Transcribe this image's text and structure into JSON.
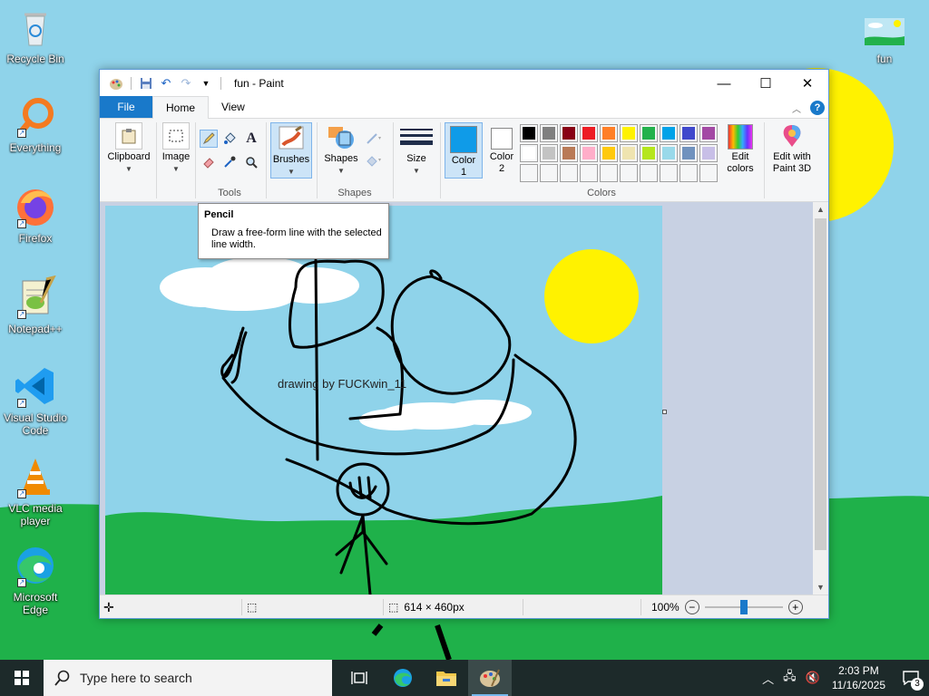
{
  "desktop": {
    "icons": [
      {
        "label": "Recycle Bin",
        "icon": "recycle-bin-icon"
      },
      {
        "label": "Everything",
        "icon": "everything-search-icon"
      },
      {
        "label": "Firefox",
        "icon": "firefox-icon"
      },
      {
        "label": "Notepad++",
        "icon": "notepadpp-icon"
      },
      {
        "label": "Visual Studio Code",
        "icon": "vscode-icon"
      },
      {
        "label": "VLC media player",
        "icon": "vlc-icon"
      },
      {
        "label": "Microsoft Edge",
        "icon": "edge-icon"
      },
      {
        "label": "fun",
        "icon": "image-file-icon"
      }
    ]
  },
  "window": {
    "title": "fun - Paint",
    "tabs": [
      {
        "label": "File"
      },
      {
        "label": "Home"
      },
      {
        "label": "View"
      }
    ],
    "ribbon": {
      "clipboard": "Clipboard",
      "image": "Image",
      "tools": "Tools",
      "brushes": "Brushes",
      "shapes_btn": "Shapes",
      "shapes_group": "Shapes",
      "size": "Size",
      "color1": "Color 1",
      "color2": "Color 2",
      "colors_group": "Colors",
      "edit_colors": "Edit colors",
      "edit_paint3d": "Edit with Paint 3D",
      "text_tool": "A",
      "color1_value": "#0f9be8",
      "color2_value": "#ffffff",
      "palette_row1": [
        "#000000",
        "#7f7f7f",
        "#880015",
        "#ed1c24",
        "#ff7f27",
        "#fff200",
        "#22b14c",
        "#00a2e8",
        "#3f48cc",
        "#a349a4"
      ],
      "palette_row2": [
        "#ffffff",
        "#c3c3c3",
        "#b97a57",
        "#ffaec9",
        "#ffc90e",
        "#efe4b0",
        "#b5e61d",
        "#99d9ea",
        "#7092be",
        "#c8bfe7"
      ]
    },
    "tooltip": {
      "title": "Pencil",
      "body": "Draw a free-form line with the selected line width."
    },
    "canvas": {
      "caption": "drawing by FUCKwin_11"
    },
    "status": {
      "image_size": "614 × 460px",
      "zoom": "100%",
      "zoom_fraction": 0.5
    }
  },
  "taskbar": {
    "search_placeholder": "Type here to search",
    "time": "2:03 PM",
    "date": "11/16/2025",
    "notification_count": "3"
  }
}
